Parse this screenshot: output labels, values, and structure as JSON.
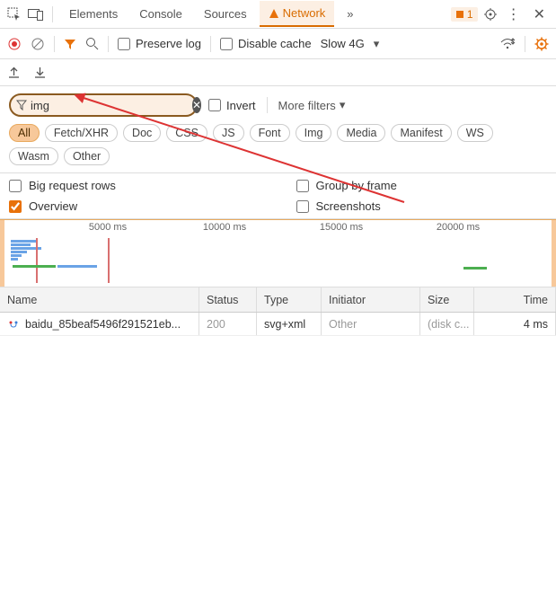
{
  "tabs": {
    "elements": "Elements",
    "console": "Console",
    "sources": "Sources",
    "network": "Network",
    "more": "»",
    "badge_count": "1"
  },
  "toolbar": {
    "preserve_log": "Preserve log",
    "disable_cache": "Disable cache",
    "throttle": "Slow 4G"
  },
  "filter": {
    "value": "img",
    "invert": "Invert",
    "more_filters": "More filters"
  },
  "chips": [
    "All",
    "Fetch/XHR",
    "Doc",
    "CSS",
    "JS",
    "Font",
    "Img",
    "Media",
    "Manifest",
    "WS",
    "Wasm",
    "Other"
  ],
  "options": {
    "big_rows": "Big request rows",
    "overview": "Overview",
    "group_frame": "Group by frame",
    "screenshots": "Screenshots"
  },
  "timeline": {
    "ticks": [
      "5000 ms",
      "10000 ms",
      "15000 ms",
      "20000 ms"
    ]
  },
  "columns": {
    "name": "Name",
    "status": "Status",
    "type": "Type",
    "initiator": "Initiator",
    "size": "Size",
    "time": "Time"
  },
  "rows": [
    {
      "name": "baidu_85beaf5496f291521eb...",
      "status": "200",
      "type": "svg+xml",
      "initiator": "Other",
      "size": "(disk c...",
      "time": "4 ms"
    }
  ]
}
